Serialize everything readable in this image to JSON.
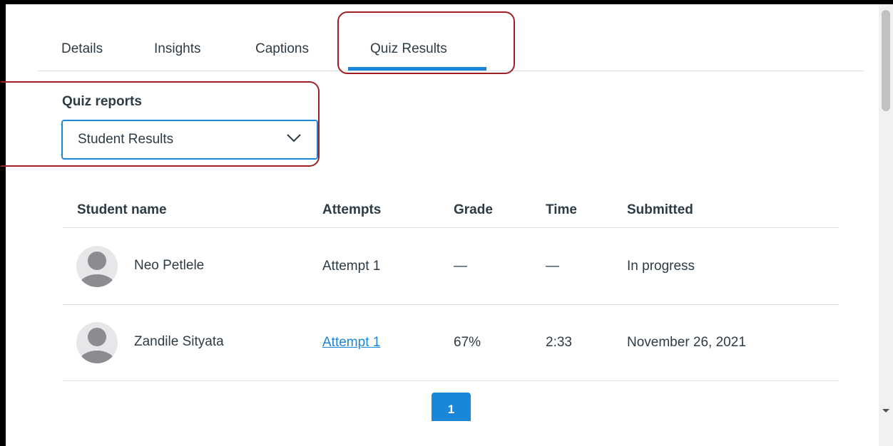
{
  "tabs": [
    {
      "label": "Details",
      "active": false
    },
    {
      "label": "Insights",
      "active": false
    },
    {
      "label": "Captions",
      "active": false
    },
    {
      "label": "Quiz Results",
      "active": true
    }
  ],
  "reports": {
    "label": "Quiz reports",
    "selected": "Student Results"
  },
  "table": {
    "headers": [
      "Student name",
      "Attempts",
      "Grade",
      "Time",
      "Submitted"
    ],
    "rows": [
      {
        "name": "Neo Petlele",
        "attempt": "Attempt 1",
        "attempt_link": false,
        "grade": "—",
        "time": "—",
        "submitted": "In progress"
      },
      {
        "name": "Zandile Sityata",
        "attempt": "Attempt 1",
        "attempt_link": true,
        "grade": "67%",
        "time": "2:33",
        "submitted": "November 26, 2021"
      }
    ]
  },
  "pagination": {
    "current_page": "1"
  },
  "colors": {
    "accent": "#1a86d8",
    "highlight": "#a01f24",
    "text": "#2d3b45"
  }
}
